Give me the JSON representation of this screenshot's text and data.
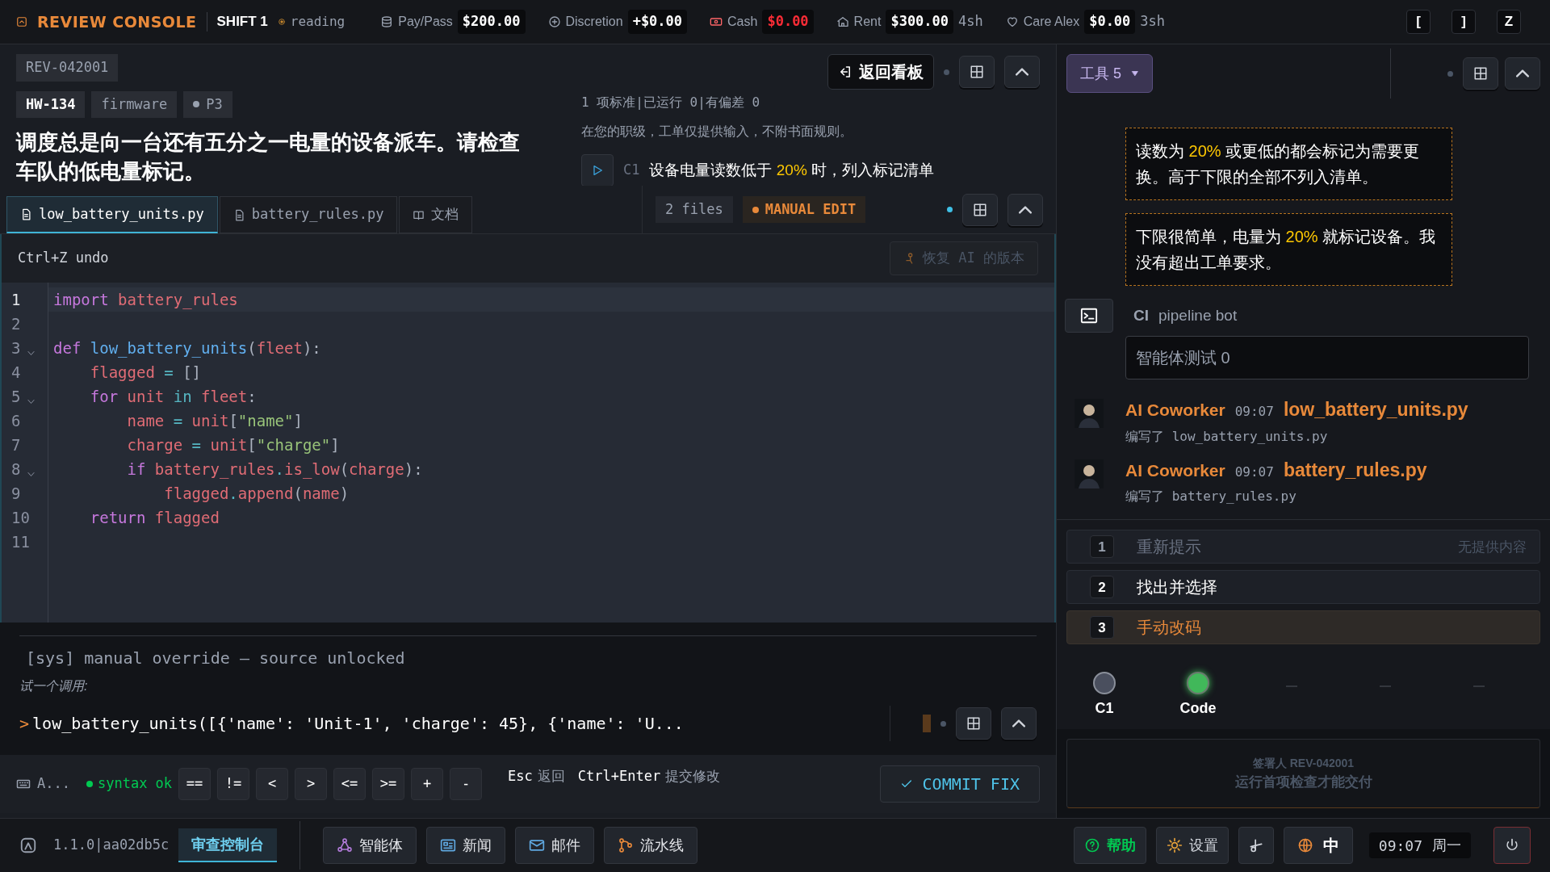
{
  "top_bar": {
    "title": "REVIEW CONSOLE",
    "shift": "SHIFT 1",
    "status": "reading",
    "stats": [
      {
        "kind": "coins",
        "label": "Pay/Pass",
        "value": "$200.00",
        "alert": false
      },
      {
        "kind": "plus",
        "label": "Discretion",
        "value": "+$0.00",
        "alert": false
      },
      {
        "kind": "cash",
        "label": "Cash",
        "value": "$0.00",
        "alert": true
      },
      {
        "kind": "home",
        "label": "Rent",
        "value": "$300.00",
        "alert": false,
        "suffix": "4sh"
      },
      {
        "kind": "heart",
        "label": "Care Alex",
        "value": "$0.00",
        "alert": false,
        "suffix": "3sh"
      }
    ],
    "keys": [
      "[",
      "]",
      "Z"
    ]
  },
  "ticket": {
    "id": "REV-042001",
    "tags": [
      {
        "kind": "id",
        "text": "HW-134"
      },
      {
        "kind": "plain",
        "text": "firmware"
      },
      {
        "kind": "priority",
        "text": "P3"
      }
    ],
    "summary": "调度总是向一台还有五分之一电量的设备派车。请检查车队的低电量标记。",
    "back_button": "返回看板",
    "criteria_summary": "1 项标准|已运行 0|有偏差 0",
    "note": "在您的职级，工单仅提供输入，不附书面规则。",
    "criteria": [
      {
        "id": "C1",
        "text": "设备电量读数低于 **20%** 时，列入标记清单"
      }
    ]
  },
  "tabs": [
    {
      "kind": "file",
      "label": "low_battery_units.py",
      "selected": true
    },
    {
      "kind": "file",
      "label": "battery_rules.py",
      "selected": false
    },
    {
      "kind": "doc",
      "label": "文档",
      "selected": false
    }
  ],
  "editor": {
    "files": "2 files",
    "mode": "MANUAL EDIT",
    "undo_hint": "Ctrl+Z undo",
    "restore": {
      "label": "恢复 AI 的版本",
      "disabled": true
    },
    "lines": [
      {
        "number": "1",
        "fold": false,
        "current": true,
        "tokens": [
          {
            "kind": "kw",
            "text": "import "
          },
          {
            "kind": "var",
            "text": "battery_rules"
          }
        ]
      },
      {
        "number": "2",
        "fold": false,
        "current": false
      },
      {
        "number": "3",
        "fold": true,
        "current": false,
        "tokens": [
          {
            "kind": "kw",
            "text": "def "
          },
          {
            "kind": "func",
            "text": "low_battery_units"
          },
          {
            "kind": "punct",
            "text": "("
          },
          {
            "kind": "var",
            "text": "fleet"
          },
          {
            "kind": "punct",
            "text": "):"
          }
        ]
      },
      {
        "number": "4",
        "fold": false,
        "current": false,
        "tokens": [
          {
            "kind": "var",
            "text": "    flagged"
          },
          {
            "kind": "op",
            "text": " = "
          },
          {
            "kind": "punct",
            "text": "[]"
          }
        ]
      },
      {
        "number": "5",
        "fold": true,
        "current": false,
        "tokens": [
          {
            "kind": "kw",
            "text": "    for "
          },
          {
            "kind": "var",
            "text": "unit "
          },
          {
            "kind": "op",
            "text": "in "
          },
          {
            "kind": "var",
            "text": "fleet"
          },
          {
            "kind": "punct",
            "text": ":"
          }
        ]
      },
      {
        "number": "6",
        "fold": false,
        "current": false,
        "tokens": [
          {
            "kind": "var",
            "text": "        name"
          },
          {
            "kind": "op",
            "text": " = "
          },
          {
            "kind": "var",
            "text": "unit"
          },
          {
            "kind": "punct",
            "text": "["
          },
          {
            "kind": "str",
            "text": "\"name\""
          },
          {
            "kind": "punct",
            "text": "]"
          }
        ]
      },
      {
        "number": "7",
        "fold": false,
        "current": false,
        "tokens": [
          {
            "kind": "var",
            "text": "        charge"
          },
          {
            "kind": "op",
            "text": " = "
          },
          {
            "kind": "var",
            "text": "unit"
          },
          {
            "kind": "punct",
            "text": "["
          },
          {
            "kind": "str",
            "text": "\"charge\""
          },
          {
            "kind": "punct",
            "text": "]"
          }
        ]
      },
      {
        "number": "8",
        "fold": true,
        "current": false,
        "tokens": [
          {
            "kind": "kw",
            "text": "        if "
          },
          {
            "kind": "var",
            "text": "battery_rules"
          },
          {
            "kind": "op",
            "text": "."
          },
          {
            "kind": "var",
            "text": "is_low"
          },
          {
            "kind": "punct",
            "text": "("
          },
          {
            "kind": "var",
            "text": "charge"
          },
          {
            "kind": "punct",
            "text": "):"
          }
        ]
      },
      {
        "number": "9",
        "fold": false,
        "current": false,
        "tokens": [
          {
            "kind": "var",
            "text": "            flagged"
          },
          {
            "kind": "op",
            "text": "."
          },
          {
            "kind": "var",
            "text": "append"
          },
          {
            "kind": "punct",
            "text": "("
          },
          {
            "kind": "var",
            "text": "name"
          },
          {
            "kind": "punct",
            "text": ")"
          }
        ]
      },
      {
        "number": "10",
        "fold": false,
        "current": false,
        "tokens": [
          {
            "kind": "kw",
            "text": "    return "
          },
          {
            "kind": "var",
            "text": "flagged"
          }
        ]
      },
      {
        "number": "11",
        "fold": false,
        "current": false
      }
    ]
  },
  "console": {
    "log": "[sys] manual override — source unlocked",
    "hint": "试一个调用:",
    "prompt": ">",
    "input": "low_battery_units([{'name': 'Unit-1', 'charge': 45}, {'name': 'U..."
  },
  "key_bar": {
    "keyboard": "A...",
    "syntax": "syntax ok",
    "operators": [
      "==",
      "!=",
      "<",
      ">",
      "<=",
      ">=",
      "+",
      "-"
    ],
    "hints": [
      {
        "key": "Esc",
        "action": "返回"
      },
      {
        "key": "Ctrl+Enter",
        "action": "提交修改"
      }
    ],
    "commit": "COMMIT FIX"
  },
  "side": {
    "tools": {
      "label": "工具",
      "count": "5"
    },
    "messages": [
      {
        "text": "读数为 **20%** 或更低的都会标记为需要更换。高于下限的全部不列入清单。"
      },
      {
        "text": "下限很简单，电量为 **20%** 就标记设备。我没有超出工单要求。"
      }
    ],
    "ci": {
      "label": "CI",
      "name": "pipeline bot",
      "result": "智能体测试 0"
    },
    "events": [
      {
        "author": "AI Coworker",
        "time": "09:07",
        "file": "low_battery_units.py",
        "detail": "编写了 low_battery_units.py"
      },
      {
        "author": "AI Coworker",
        "time": "09:07",
        "file": "battery_rules.py",
        "detail": "编写了 battery_rules.py"
      }
    ],
    "options": [
      {
        "number": "1",
        "label": "重新提示",
        "note": "无提供内容",
        "disabled": true,
        "selected": false
      },
      {
        "number": "2",
        "label": "找出并选择",
        "disabled": false,
        "selected": false
      },
      {
        "number": "3",
        "label": "手动改码",
        "disabled": false,
        "selected": true
      }
    ],
    "checks": [
      {
        "kind": "idle",
        "label": "C1"
      },
      {
        "kind": "pass",
        "label": "Code"
      },
      {
        "kind": "empty"
      },
      {
        "kind": "empty"
      },
      {
        "kind": "empty"
      }
    ],
    "stamp": [
      "签署人 REV-042001",
      "运行首项检查才能交付"
    ]
  },
  "footer": {
    "version": "1.1.0|aa02db5c",
    "tabs": [
      {
        "label": "审查控制台",
        "selected": true
      }
    ],
    "apps": [
      {
        "kind": "agents",
        "label": "智能体"
      },
      {
        "kind": "news",
        "label": "新闻"
      },
      {
        "kind": "mail",
        "label": "邮件"
      },
      {
        "kind": "pipeline",
        "label": "流水线"
      }
    ],
    "help": "帮助",
    "settings": "设置",
    "language": "中",
    "clock": "09:07",
    "weekday": "周一"
  }
}
